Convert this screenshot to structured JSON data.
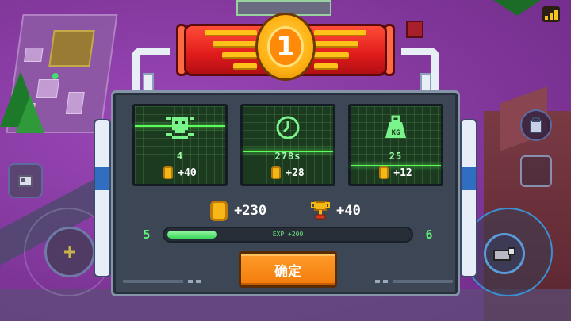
{
  "rank": {
    "number": "1"
  },
  "stats": [
    {
      "name": "kills",
      "icon": "skull-crossbones-icon",
      "value": "4",
      "reward": "+40"
    },
    {
      "name": "time",
      "icon": "clock-icon",
      "value": "278s",
      "reward": "+28"
    },
    {
      "name": "weight",
      "icon": "weight-kg-icon",
      "value": "25",
      "reward": "+12"
    }
  ],
  "totals": {
    "coins": "+230",
    "trophies": "+40"
  },
  "experience": {
    "current_level": "5",
    "next_level": "6",
    "gain_label": "EXP +200",
    "progress": 0.2
  },
  "confirm_label": "确定",
  "colors": {
    "accent_green": "#5cff5c",
    "confirm_orange": "#f27b0a",
    "badge_red": "#e01b1b",
    "coin_gold": "#f7b817"
  },
  "hud": {
    "left_button_icon": "cube-icon",
    "joystick_icon": "plus-icon",
    "fire_button_icon": "cannon-icon",
    "right_top_icon": "backpack-icon",
    "signal_icon": "signal-bars-icon"
  }
}
